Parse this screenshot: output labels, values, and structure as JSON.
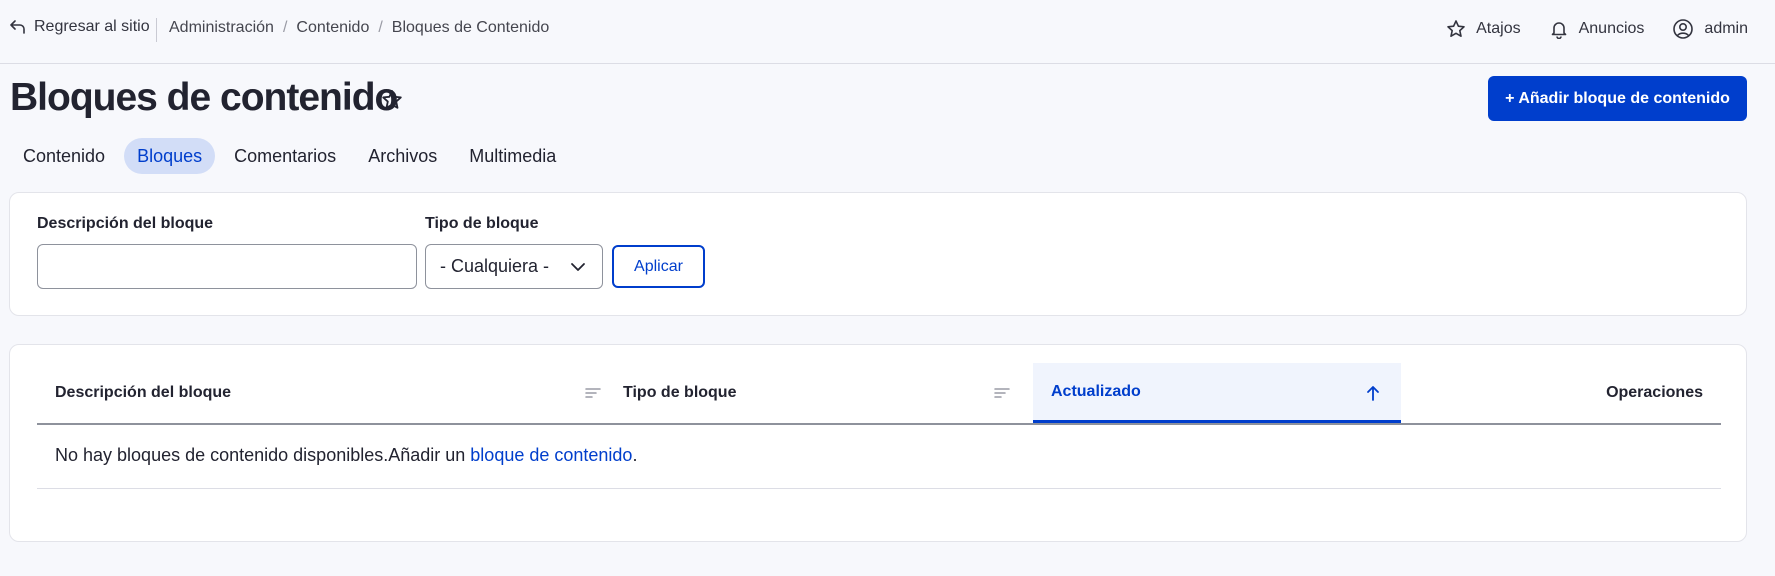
{
  "topbar": {
    "back_label": "Regresar al sitio",
    "breadcrumb": [
      "Administración",
      "Contenido",
      "Bloques de Contenido"
    ],
    "breadcrumb_separator": "/",
    "actions": [
      {
        "icon": "star-icon",
        "label": "Atajos"
      },
      {
        "icon": "bell-icon",
        "label": "Anuncios"
      },
      {
        "icon": "user-icon",
        "label": "admin"
      }
    ]
  },
  "page": {
    "title": "Bloques de contenido",
    "add_button": "+ Añadir bloque de contenido"
  },
  "tabs": [
    {
      "label": "Contenido",
      "active": false
    },
    {
      "label": "Bloques",
      "active": true
    },
    {
      "label": "Comentarios",
      "active": false
    },
    {
      "label": "Archivos",
      "active": false
    },
    {
      "label": "Multimedia",
      "active": false
    }
  ],
  "filters": {
    "description_label": "Descripción del bloque",
    "description_value": "",
    "type_label": "Tipo de bloque",
    "type_selected": "- Cualquiera -",
    "apply_label": "Aplicar"
  },
  "table": {
    "columns": [
      {
        "label": "Descripción del bloque",
        "sorted": false
      },
      {
        "label": "Tipo de bloque",
        "sorted": false
      },
      {
        "label": "Actualizado",
        "sorted": true,
        "direction": "asc"
      },
      {
        "label": "Operaciones",
        "sorted": false
      }
    ],
    "empty_text": "No hay bloques de contenido disponibles.Añadir un ",
    "empty_link": "bloque de contenido",
    "empty_end": "."
  },
  "colors": {
    "accent": "#003ecc",
    "active_tab_bg": "#d2ddf7",
    "page_bg": "#f7f8fc"
  }
}
